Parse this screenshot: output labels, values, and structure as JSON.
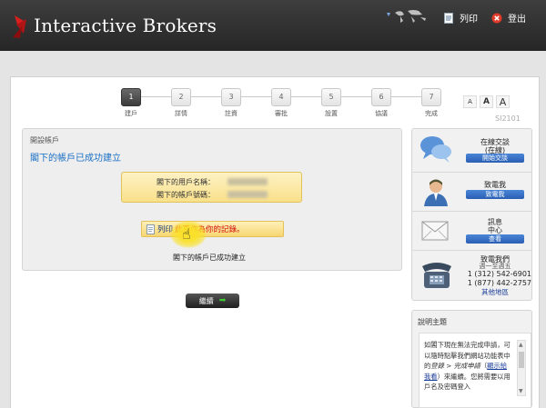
{
  "header": {
    "brand": "Interactive Brokers",
    "print": "列印",
    "logout": "登出"
  },
  "steps": [
    {
      "num": "1",
      "label": "建戶",
      "active": true
    },
    {
      "num": "2",
      "label": "詳情",
      "active": false
    },
    {
      "num": "3",
      "label": "註資",
      "active": false
    },
    {
      "num": "4",
      "label": "審批",
      "active": false
    },
    {
      "num": "5",
      "label": "設置",
      "active": false
    },
    {
      "num": "6",
      "label": "協議",
      "active": false
    },
    {
      "num": "7",
      "label": "完成",
      "active": false
    }
  ],
  "font_size_controls": [
    "A",
    "A",
    "A"
  ],
  "page_code": "SI2101",
  "card": {
    "title": "開設帳戶",
    "message": "閣下的帳戶已成功建立",
    "username_label": "閣下的用戶名稱：",
    "account_label": "閣下的帳戶號碼：",
    "print_label": "列印",
    "print_note": "此頁作為你的記錄。",
    "success_text": "閣下的帳戶已成功建立"
  },
  "continue_button": "繼續",
  "sidebar": {
    "chat": {
      "title": "在線交談",
      "subtitle": "(在線)",
      "button": "開始交談"
    },
    "call": {
      "title": "致電我",
      "button": "致電我"
    },
    "message": {
      "title": "訊息",
      "subtitle": "中心",
      "button": "查看"
    },
    "phone": {
      "title": "致電我們",
      "subtitle": "週一至週五",
      "phone1": "1 (312) 542-6901",
      "phone2": "1 (877) 442-2757",
      "link": "其他地區"
    }
  },
  "help": {
    "title": "說明主題",
    "text_1": "如閣下現在無法完成申請，可以隨時點擊我們網站功能表中的",
    "text_italic": "登錄 > 完成申請",
    "text_link": "顯示給我看",
    "text_2": "來繼續。您將需要以用戶名及密碼登入"
  },
  "colors": {
    "header_bg": "#2f2f2f",
    "link_blue": "#1a6fc4",
    "accent_red": "#d01010",
    "button_blue": "#2a5fb3",
    "highlight_yellow": "#f9e08a"
  }
}
